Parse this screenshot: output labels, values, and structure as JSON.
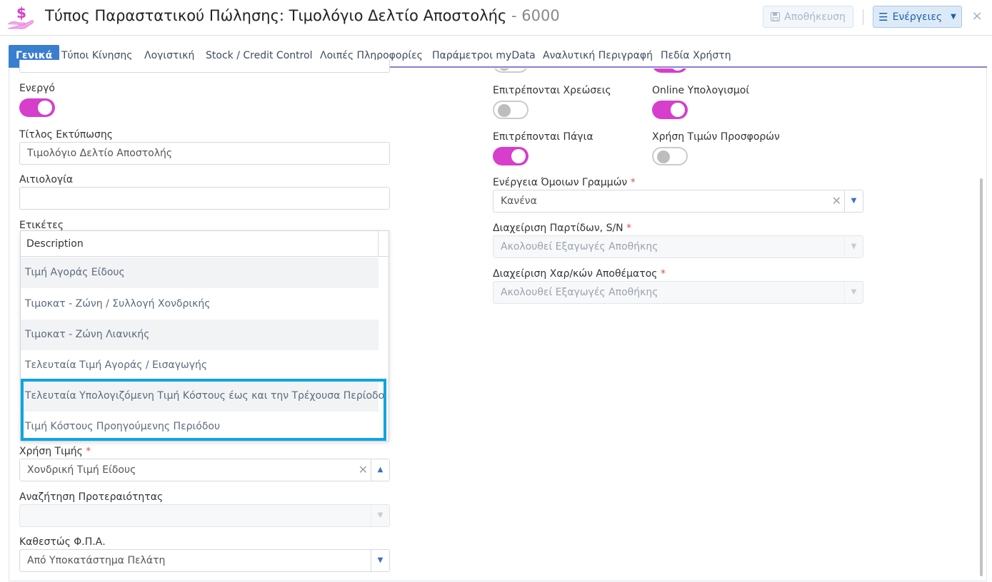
{
  "header": {
    "title": "Τύπος Παραστατικού Πώλησης: Τιμολόγιο Δελτίο Αποστολής",
    "separator": "-",
    "code": "6000",
    "save_label": "Αποθήκευση",
    "actions_label": "Ενέργειες",
    "close_symbol": "×",
    "app_icon": "dollar-hand-icon"
  },
  "tabs": [
    {
      "label": "Γενικά",
      "active": true
    },
    {
      "label": "Τύποι Κίνησης"
    },
    {
      "label": "Λογιστική"
    },
    {
      "label": "Stock / Credit Control"
    },
    {
      "label": "Λοιπές Πληροφορίες"
    },
    {
      "label": "Παράμετροι myData"
    },
    {
      "label": "Αναλυτική Περιγραφή"
    },
    {
      "label": "Πεδία Χρήστη"
    }
  ],
  "left": {
    "active_label": "Ενεργό",
    "active_value": true,
    "print_title_label": "Τίτλος Εκτύπωσης",
    "print_title_value": "Τιμολόγιο Δελτίο Αποστολής",
    "reason_label": "Αιτιολογία",
    "reason_value": "",
    "tags_label": "Ετικέτες",
    "price_use_label": "Χρήση Τιμής",
    "price_use_value": "Χονδρική Τιμή Είδους",
    "priority_search_label": "Αναζήτηση Προτεραιότητας",
    "priority_search_value": "",
    "vat_status_label": "Καθεστώς Φ.Π.Α.",
    "vat_status_value": "Από Υποκατάστημα Πελάτη"
  },
  "dropdown": {
    "column_header": "Description",
    "options": [
      "Τιμή Αγοράς Είδους",
      "Τιμοκατ - Ζώνη / Συλλογή Χονδρικής",
      "Τιμοκατ - Ζώνη Λιανικής",
      "Τελευταία Τιμή Αγοράς / Εισαγωγής",
      "Τελευταία Υπολογιζόμενη Τιμή Κόστους έως και την Τρέχουσα Περίοδο",
      "Τιμή Κόστους Προηγούμενης Περιόδου"
    ],
    "highlight_color": "#0ea5e0"
  },
  "right": {
    "allow_charges_label": "Επιτρέπονται Χρεώσεις",
    "allow_charges_value": false,
    "online_calc_label": "Online Υπολογισμοί",
    "online_calc_value": true,
    "allow_fixed_assets_label": "Επιτρέπονται Πάγια",
    "allow_fixed_assets_value": true,
    "use_offer_prices_label": "Χρήση Τιμών Προσφορών",
    "use_offer_prices_value": false,
    "similar_lines_label": "Ενέργεια Όμοιων Γραμμών",
    "similar_lines_value": "Κανένα",
    "batches_label": "Διαχείριση Παρτίδων, S/N",
    "batches_value": "Ακολουθεί Εξαγωγές Αποθήκης",
    "stock_chars_label": "Διαχείριση Χαρ/κών Αποθέματος",
    "stock_chars_value": "Ακολουθεί Εξαγωγές Αποθήκης"
  },
  "required_mark": "*",
  "colors": {
    "accent": "#3a7ecf",
    "toggle_on": "#d63ecb"
  }
}
